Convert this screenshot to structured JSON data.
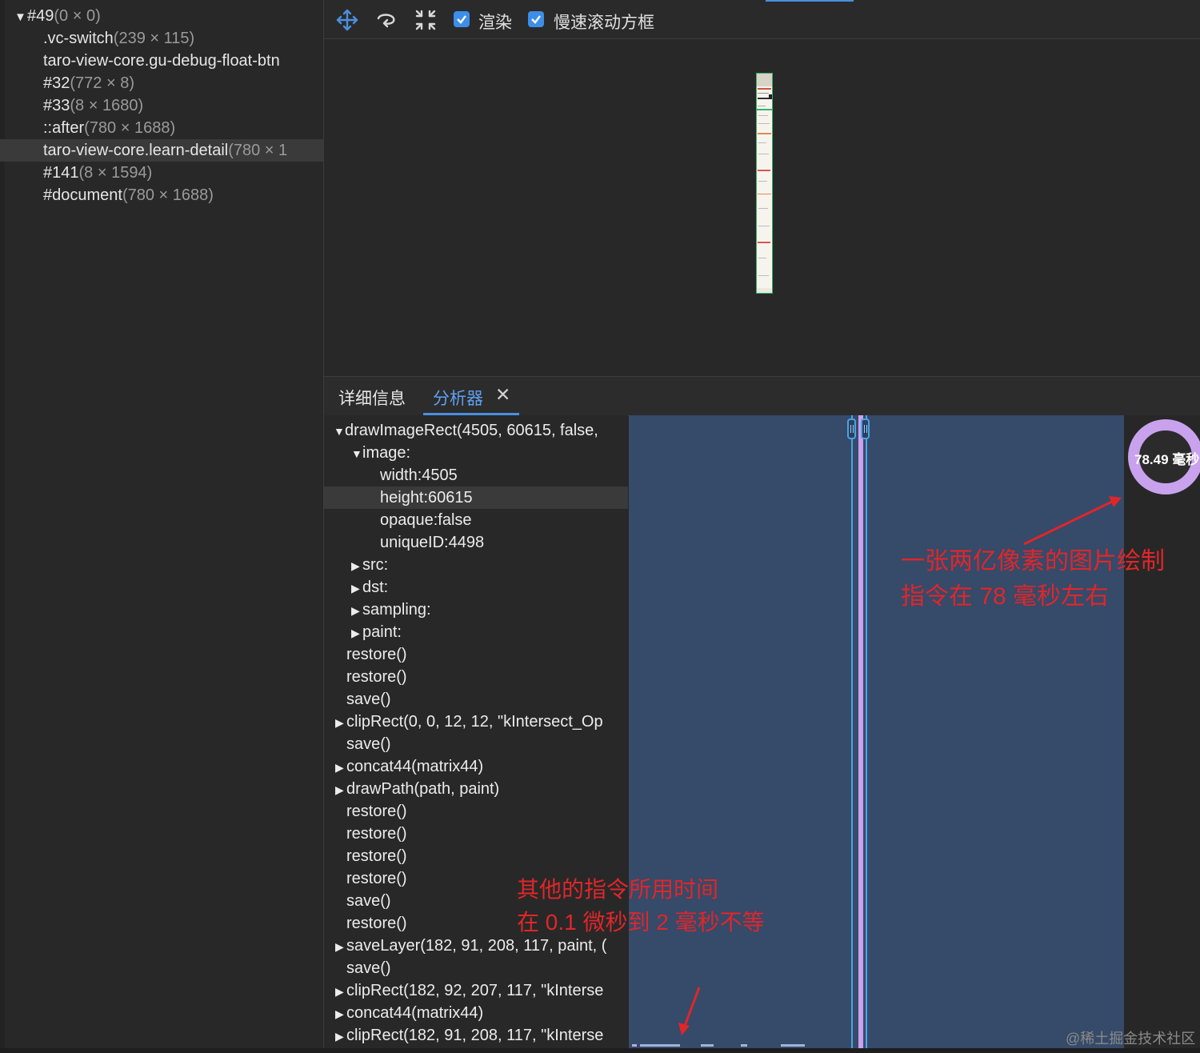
{
  "layer_tree": {
    "rows": [
      {
        "name": "#49",
        "size": "(0 × 0)",
        "expanded": true
      },
      {
        "name": ".vc-switch",
        "size": "(239 × 115)"
      },
      {
        "name": "taro-view-core.gu-debug-float-btn",
        "size": ""
      },
      {
        "name": "#32",
        "size": "(772 × 8)"
      },
      {
        "name": "#33",
        "size": "(8 × 1680)"
      },
      {
        "name": "::after",
        "size": "(780 × 1688)"
      },
      {
        "name": "taro-view-core.learn-detail",
        "size": "(780 × 1",
        "selected": true
      },
      {
        "name": "#141",
        "size": "(8 × 1594)"
      },
      {
        "name": "#document",
        "size": "(780 × 1688)"
      }
    ]
  },
  "toolbar": {
    "icons": [
      "move-icon",
      "rotate-icon",
      "fit-icon"
    ],
    "render_checkbox": {
      "label": "渲染",
      "checked": true
    },
    "slow_scroll_checkbox": {
      "label": "慢速滚动方框",
      "checked": true
    }
  },
  "tabs": [
    {
      "label": "详细信息",
      "active": false
    },
    {
      "label": "分析器",
      "active": true,
      "close": "✕"
    }
  ],
  "commands": [
    {
      "text": "drawImageRect(4505, 60615, false,",
      "arrow": "down"
    },
    {
      "text": "image:",
      "arrow": "down"
    },
    {
      "text": "width:4505",
      "arrow": ""
    },
    {
      "text": "height:60615",
      "arrow": "",
      "selected": true
    },
    {
      "text": "opaque:false",
      "arrow": ""
    },
    {
      "text": "uniqueID:4498",
      "arrow": ""
    },
    {
      "text": "src:",
      "arrow": "right"
    },
    {
      "text": "dst:",
      "arrow": "right"
    },
    {
      "text": "sampling:",
      "arrow": "right"
    },
    {
      "text": "paint:",
      "arrow": "right"
    },
    {
      "text": "restore()",
      "arrow": ""
    },
    {
      "text": "restore()",
      "arrow": ""
    },
    {
      "text": "save()",
      "arrow": ""
    },
    {
      "text": "clipRect(0, 0, 12, 12, \"kIntersect_Op",
      "arrow": "right"
    },
    {
      "text": "save()",
      "arrow": ""
    },
    {
      "text": "concat44(matrix44)",
      "arrow": "right"
    },
    {
      "text": "drawPath(path, paint)",
      "arrow": "right"
    },
    {
      "text": "restore()",
      "arrow": ""
    },
    {
      "text": "restore()",
      "arrow": ""
    },
    {
      "text": "restore()",
      "arrow": ""
    },
    {
      "text": "restore()",
      "arrow": ""
    },
    {
      "text": "save()",
      "arrow": ""
    },
    {
      "text": "restore()",
      "arrow": ""
    },
    {
      "text": "saveLayer(182, 91, 208, 117, paint, (",
      "arrow": "right"
    },
    {
      "text": "save()",
      "arrow": ""
    },
    {
      "text": "clipRect(182, 92, 207, 117, \"kInterse",
      "arrow": "right"
    },
    {
      "text": "concat44(matrix44)",
      "arrow": "right"
    },
    {
      "text": "clipRect(182, 91, 208, 117, \"kInterse",
      "arrow": "right"
    }
  ],
  "profiler": {
    "donut_value": "78.49 毫秒",
    "colors": {
      "timeline_bg": "#364a69",
      "marker": "#c9a2ee",
      "handle": "#4aa3e8"
    }
  },
  "annotations": {
    "note_top_line1": "一张两亿像素的图片绘制",
    "note_top_line2": "指令在 78 毫秒左右",
    "note_bottom_line1": "其他的指令所用时间",
    "note_bottom_line2": "在 0.1 微秒到 2 毫秒不等"
  },
  "watermark": "@稀土掘金技术社区"
}
